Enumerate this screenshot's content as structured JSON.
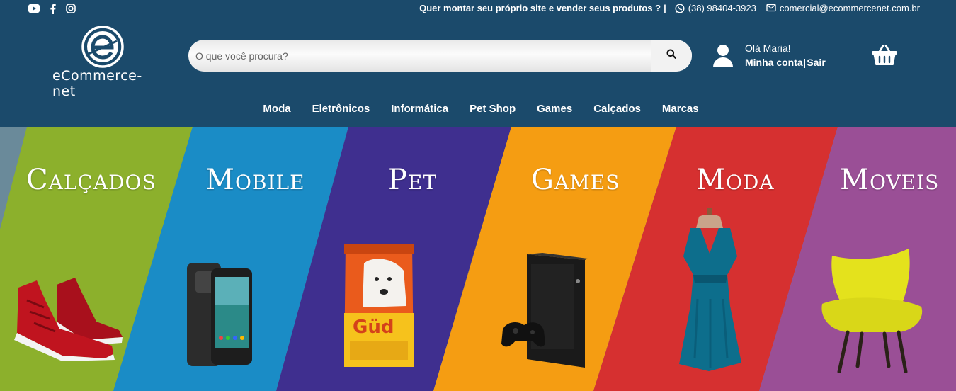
{
  "topbar": {
    "social": [
      "youtube-icon",
      "facebook-icon",
      "instagram-icon"
    ],
    "promo_text": "Quer montar seu próprio site e vender seus produtos ?",
    "separator": "|",
    "phone": "(38) 98404-3923",
    "email": "comercial@ecommercenet.com.br"
  },
  "logo": {
    "text": "eCommerce-net"
  },
  "search": {
    "placeholder": "O que você procura?"
  },
  "account": {
    "greeting": "Olá Maria!",
    "my_account": "Minha conta",
    "separator": "|",
    "logout": "Sair"
  },
  "nav": {
    "items": [
      "Moda",
      "Eletrônicos",
      "Informática",
      "Pet Shop",
      "Games",
      "Calçados",
      "Marcas"
    ]
  },
  "banner": {
    "categories": [
      {
        "title": "Calçados",
        "color": "#8cb02c"
      },
      {
        "title": "Mobile",
        "color": "#1a8cc6"
      },
      {
        "title": "Pet",
        "color": "#3f2f8f"
      },
      {
        "title": "Games",
        "color": "#f59d12"
      },
      {
        "title": "Moda",
        "color": "#d63030"
      },
      {
        "title": "Moveis",
        "color": "#9a4f96"
      }
    ]
  },
  "colors": {
    "header_bg": "#1b4a6b",
    "search_bg": "#f2f2f2"
  }
}
